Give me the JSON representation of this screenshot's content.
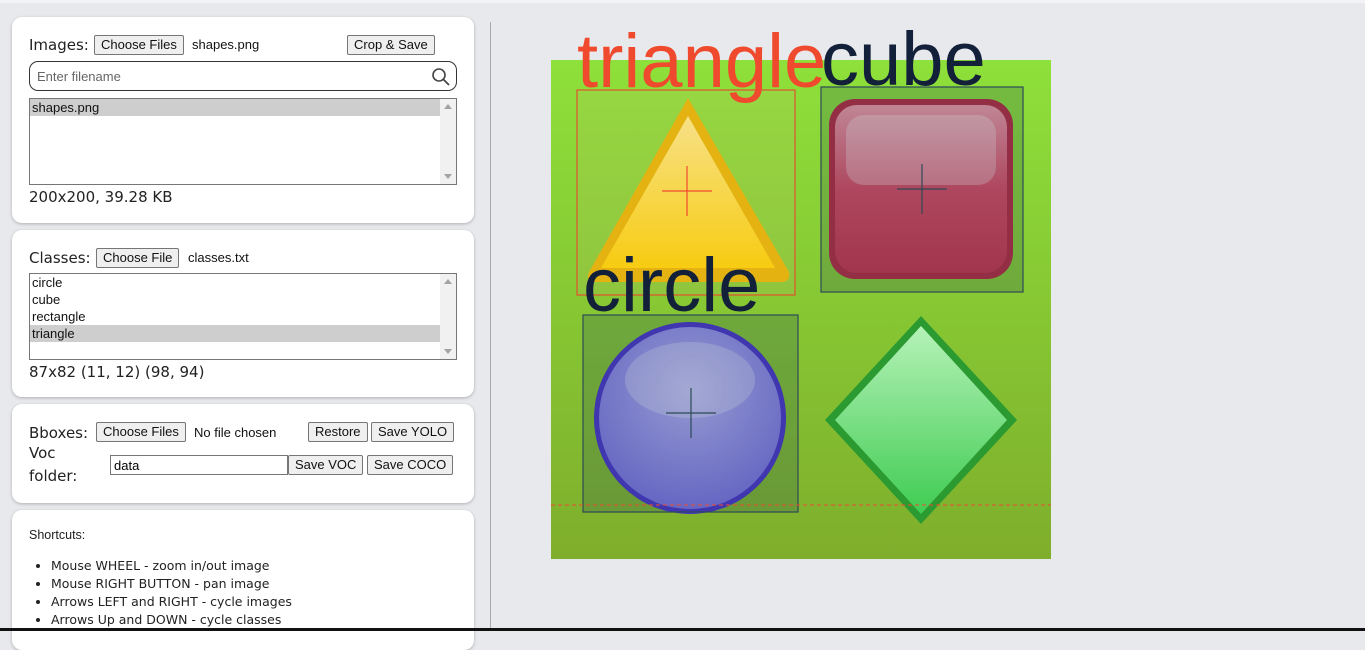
{
  "images": {
    "label": "Images:",
    "choose_label": "Choose Files",
    "filename": "shapes.png",
    "crop_label": "Crop & Save",
    "search_placeholder": "Enter filename",
    "list": [
      {
        "name": "shapes.png",
        "selected": true
      }
    ],
    "info": "200x200, 39.28 KB"
  },
  "classes": {
    "label": "Classes:",
    "choose_label": "Choose File",
    "filename": "classes.txt",
    "list": [
      {
        "name": "circle",
        "selected": false
      },
      {
        "name": "cube",
        "selected": false
      },
      {
        "name": "rectangle",
        "selected": false
      },
      {
        "name": "triangle",
        "selected": true
      }
    ],
    "info": "87x82 (11, 12) (98, 94)"
  },
  "bboxes": {
    "label": "Bboxes:",
    "choose_label": "Choose Files",
    "filename": "No file chosen",
    "restore_label": "Restore",
    "save_yolo_label": "Save YOLO",
    "voc_label_line1": "Voc",
    "voc_label_line2": "folder:",
    "voc_value": "data",
    "save_voc_label": "Save VOC",
    "save_coco_label": "Save COCO"
  },
  "shortcuts": {
    "title": "Shortcuts:",
    "items": [
      "Mouse WHEEL - zoom in/out image",
      "Mouse RIGHT BUTTON - pan image",
      "Arrows LEFT and RIGHT - cycle images",
      "Arrows Up and DOWN - cycle classes"
    ]
  },
  "canvas": {
    "labels": {
      "triangle": "triangle",
      "cube": "cube",
      "circle": "circle"
    },
    "colors": {
      "background_green": "#86d233",
      "selected_box": "#f04a2e",
      "box_outline": "#2d4a57",
      "label_dark": "#13203a",
      "triangle_yellow": "#ffd21a",
      "cube_red": "#d03c52",
      "circle_purple": "#8a80e4",
      "diamond_green": "#4ad25a"
    }
  }
}
